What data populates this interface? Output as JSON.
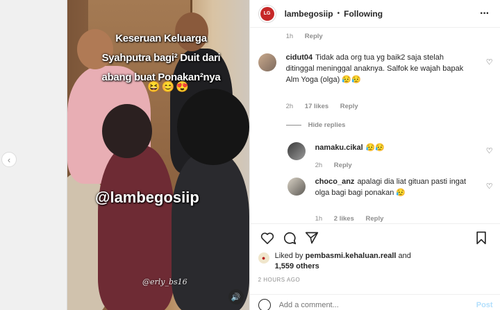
{
  "carousel": {
    "prev_icon": "chevron-left-icon"
  },
  "media": {
    "caption_lines": [
      "Keseruan Keluarga",
      "Syahputra bagi² Duit dari",
      "abang buat Ponakan²nya"
    ],
    "caption_emoji": "😆😊😍",
    "handle": "@lambegosiip",
    "watermark": "@erly_bs16",
    "sound_icon": "speaker-icon"
  },
  "header": {
    "username": "lambegosiip",
    "separator": "•",
    "follow_label": "Following",
    "more_icon": "more-horizontal-icon",
    "avatar_text": "LG"
  },
  "prev_comment_meta": {
    "time": "1h",
    "reply": "Reply"
  },
  "comments": [
    {
      "username": "cidut04",
      "text": "Tidak ada org tua yg baik2 saja stelah ditinggal meninggal anaknya. Salfok ke wajah bapak Alm Yoga (olga) 😥😥",
      "time": "2h",
      "likes": "17 likes",
      "reply": "Reply"
    }
  ],
  "hide_replies": "Hide replies",
  "replies": [
    {
      "username": "namaku.cikal",
      "text": "😥😥",
      "time": "2h",
      "reply": "Reply"
    },
    {
      "username": "choco_anz",
      "text": "apalagi dia liat gituan pasti ingat olga bagi bagi ponakan 😥",
      "time": "1h",
      "likes": "2 likes",
      "reply": "Reply"
    }
  ],
  "likes_line": {
    "prefix": "Liked by",
    "user": "pembasmi.kehaluan.reall",
    "joiner": "and",
    "others": "1,559 others"
  },
  "timestamp": "2 HOURS AGO",
  "add_comment": {
    "placeholder": "Add a comment...",
    "post_label": "Post"
  },
  "colors": {
    "post_blue": "#b2dffc",
    "meta_gray": "#8e8e8e",
    "text": "#262626"
  }
}
